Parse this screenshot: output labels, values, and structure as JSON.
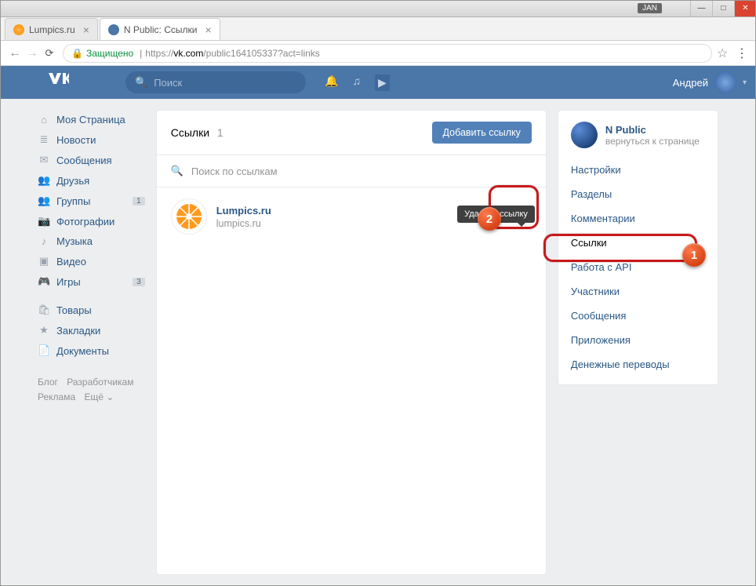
{
  "window": {
    "jan_label": "JAN"
  },
  "tabs": [
    {
      "title": "Lumpics.ru",
      "active": false
    },
    {
      "title": "N Public: Ссылки",
      "active": true
    }
  ],
  "urlbar": {
    "secure": "Защищено",
    "url_prefix": "https://",
    "url_host": "vk.com",
    "url_path": "/public164105337?act=links"
  },
  "vk_top": {
    "search_placeholder": "Поиск",
    "user_name": "Андрей"
  },
  "leftnav": {
    "items": [
      {
        "icon": "home-icon",
        "glyph": "⌂",
        "label": "Моя Страница"
      },
      {
        "icon": "news-icon",
        "glyph": "≣",
        "label": "Новости"
      },
      {
        "icon": "messages-icon",
        "glyph": "✉",
        "label": "Сообщения"
      },
      {
        "icon": "friends-icon",
        "glyph": "👥",
        "label": "Друзья"
      },
      {
        "icon": "groups-icon",
        "glyph": "👥",
        "label": "Группы",
        "badge": "1"
      },
      {
        "icon": "photos-icon",
        "glyph": "📷",
        "label": "Фотографии"
      },
      {
        "icon": "music-icon",
        "glyph": "♪",
        "label": "Музыка"
      },
      {
        "icon": "video-icon",
        "glyph": "▣",
        "label": "Видео"
      },
      {
        "icon": "games-icon",
        "glyph": "🎮",
        "label": "Игры",
        "badge": "3"
      }
    ],
    "items2": [
      {
        "icon": "market-icon",
        "glyph": "🛍",
        "label": "Товары"
      },
      {
        "icon": "bookmarks-icon",
        "glyph": "★",
        "label": "Закладки"
      },
      {
        "icon": "docs-icon",
        "glyph": "📄",
        "label": "Документы"
      }
    ],
    "footer": {
      "blog": "Блог",
      "devs": "Разработчикам",
      "ads": "Реклама",
      "more": "Ещё ⌄"
    }
  },
  "main": {
    "title": "Ссылки",
    "count": "1",
    "add_button": "Добавить ссылку",
    "search_placeholder": "Поиск по ссылкам",
    "link": {
      "title": "Lumpics.ru",
      "url": "lumpics.ru"
    },
    "tooltip": "Удалить ссылку"
  },
  "right": {
    "group_name": "N Public",
    "back_label": "вернуться к странице",
    "menu": [
      "Настройки",
      "Разделы",
      "Комментарии",
      "Ссылки",
      "Работа с API",
      "Участники",
      "Сообщения",
      "Приложения",
      "Денежные переводы"
    ],
    "active_index": 3
  },
  "callouts": {
    "one": "1",
    "two": "2"
  }
}
